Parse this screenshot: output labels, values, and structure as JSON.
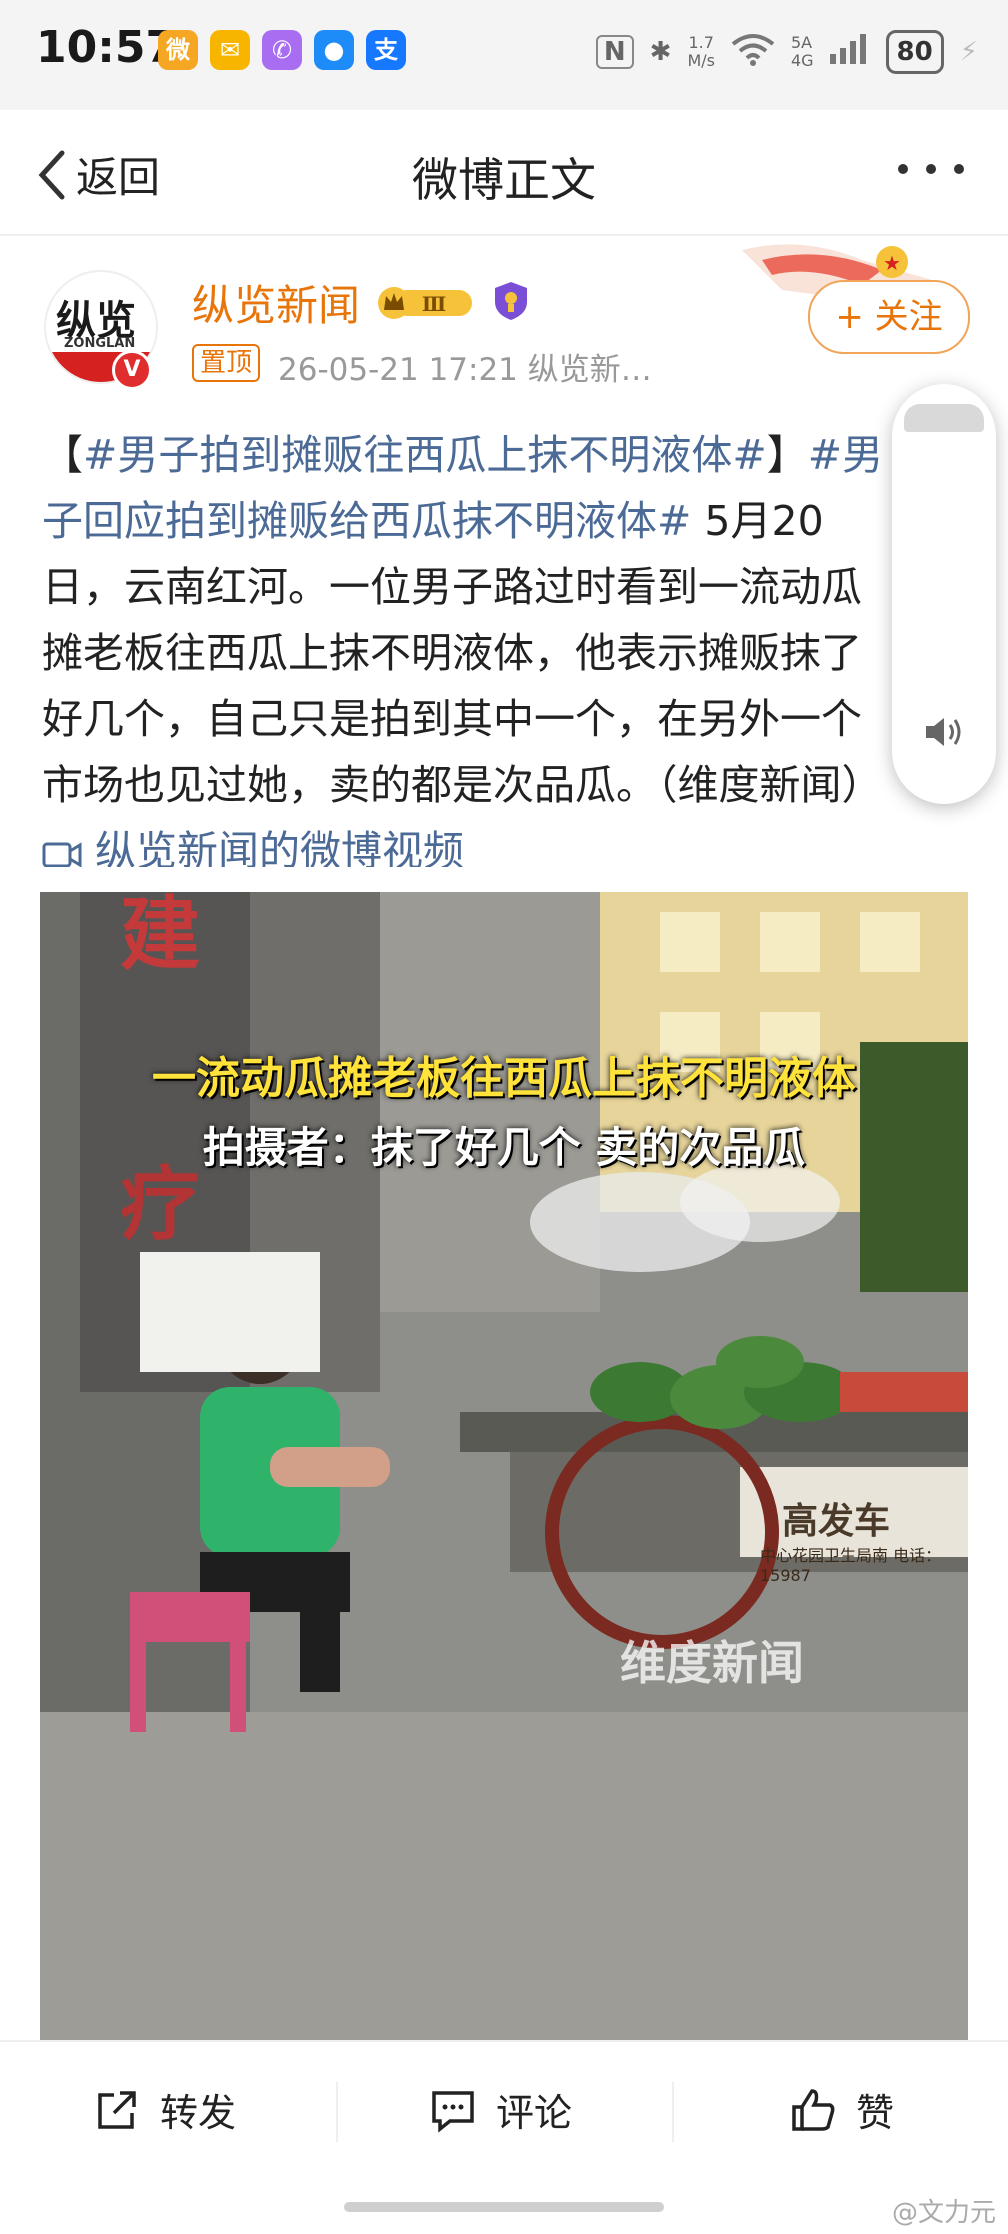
{
  "status_bar": {
    "time": "10:57",
    "apps": [
      {
        "icon": "weibo-icon",
        "glyph": "微",
        "color": "#f5a623"
      },
      {
        "icon": "mail-icon",
        "glyph": "✉",
        "color": "#f7b500"
      },
      {
        "icon": "phone-icon",
        "glyph": "✆",
        "color": "#a86df0"
      },
      {
        "icon": "bot-icon",
        "glyph": "●",
        "color": "#1d8cf8"
      },
      {
        "icon": "alipay-icon",
        "glyph": "支",
        "color": "#1677ff"
      }
    ],
    "nfc": "N",
    "net_speed_top": "1.7",
    "net_speed_bottom": "M/s",
    "sig_top": "5A",
    "sig_bottom": "4G",
    "battery": "80"
  },
  "header": {
    "back_label": "返回",
    "title": "微博正文"
  },
  "post": {
    "author": "纵览新闻",
    "avatar_text": "纵览",
    "avatar_sub": "ZONGLAN",
    "level_badge": "Ⅲ",
    "pinned": "置顶",
    "meta": "26-05-21 17:21  纵览新…",
    "follow": "+ 关注",
    "text_1": "【",
    "tag_1": "#男子拍到摊贩往西瓜上抹不明液体#",
    "text_2": "】",
    "tag_2": "#男子回应拍到摊贩给西瓜抹不明液体#",
    "body": " 5月20日，云南红河。一位男子路过时看到一流动瓜摊老板往西瓜上抹不明液体，他表示摊贩抹了好几个，自己只是拍到其中一个，在另外一个市场也见过她，卖的都是次品瓜。（维度新闻）",
    "video_link": "纵览新闻的微博视频"
  },
  "image": {
    "caption_1": "一流动瓜摊老板往西瓜上抹不明液体",
    "caption_2": "拍摄者：抹了好几个 卖的次品瓜",
    "watermark": "维度新闻",
    "stall_sign": "高发车",
    "stall_sub": "中心花园卫生局南 电话：15987"
  },
  "actions": {
    "repost": "转发",
    "comment": "评论",
    "like": "赞"
  },
  "footer_watermark": "@文力元"
}
